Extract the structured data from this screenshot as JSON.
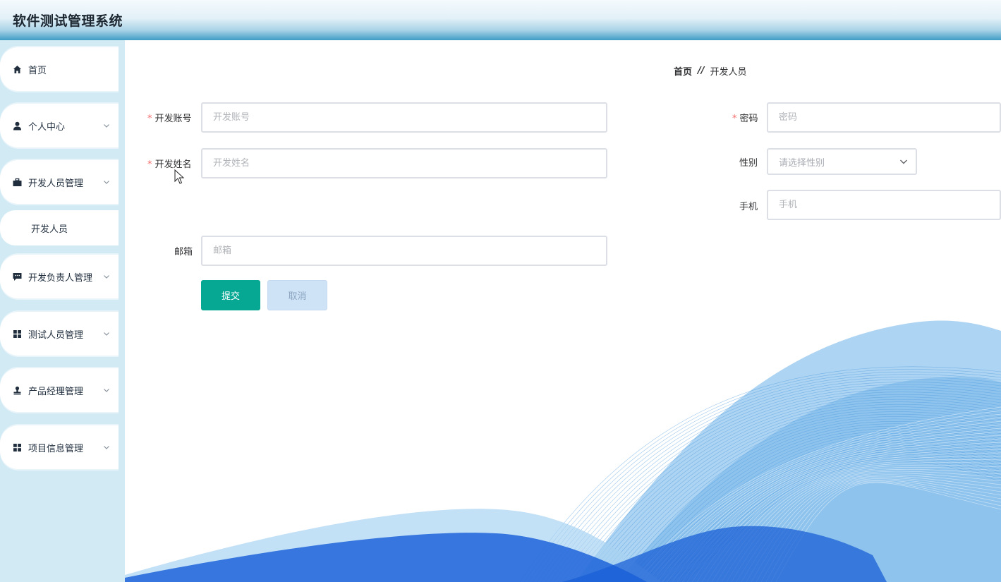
{
  "app": {
    "title": "软件测试管理系统"
  },
  "sidebar": {
    "items": [
      {
        "label": "首页",
        "icon": "home-icon"
      },
      {
        "label": "个人中心",
        "icon": "user-icon",
        "expandable": true
      },
      {
        "label": "开发人员管理",
        "icon": "briefcase-icon",
        "expandable": true
      },
      {
        "label": "开发负责人管理",
        "icon": "chat-icon",
        "expandable": true
      },
      {
        "label": "测试人员管理",
        "icon": "grid-icon",
        "expandable": true
      },
      {
        "label": "产品经理管理",
        "icon": "stamp-icon",
        "expandable": true
      },
      {
        "label": "项目信息管理",
        "icon": "grid-icon",
        "expandable": true
      }
    ],
    "subitem": {
      "label": "开发人员"
    }
  },
  "breadcrumb": {
    "home": "首页",
    "separator": "//",
    "current": "开发人员"
  },
  "form": {
    "account": {
      "label": "开发账号",
      "placeholder": "开发账号",
      "required": true
    },
    "password": {
      "label": "密码",
      "placeholder": "密码",
      "required": true
    },
    "name": {
      "label": "开发姓名",
      "placeholder": "开发姓名",
      "required": true
    },
    "gender": {
      "label": "性别",
      "placeholder": "请选择性别"
    },
    "phone": {
      "label": "手机",
      "placeholder": "手机"
    },
    "email": {
      "label": "邮箱",
      "placeholder": "邮箱"
    },
    "required_mark": "*"
  },
  "buttons": {
    "submit": "提交",
    "cancel": "取消"
  },
  "colors": {
    "accent": "#06a894",
    "header_blue": "#3f9cc5",
    "sidebar_bg": "#d1eaf4",
    "required": "#f56c6c"
  }
}
